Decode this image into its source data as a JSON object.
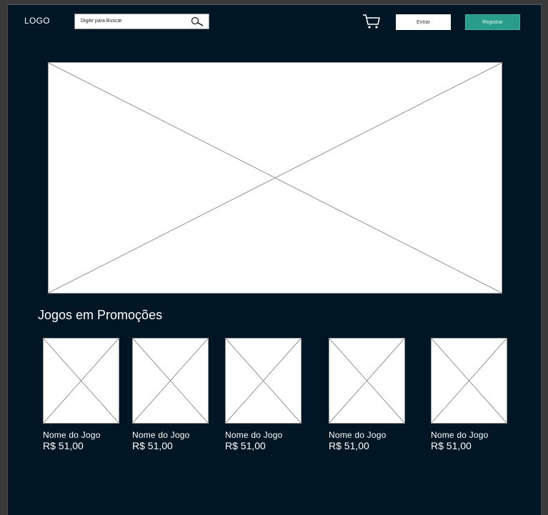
{
  "header": {
    "logo": "LOGO",
    "search_placeholder": "Digite para Buscar",
    "login_label": "Entrar",
    "register_label": "Registrar",
    "icons": [
      "search-icon",
      "cart-icon"
    ]
  },
  "section": {
    "title": "Jogos em Promoções"
  },
  "games": [
    {
      "name": "Nome do Jogo",
      "price": "R$ 51,00"
    },
    {
      "name": "Nome do Jogo",
      "price": "R$ 51,00"
    },
    {
      "name": "Nome do Jogo",
      "price": "R$ 51,00"
    },
    {
      "name": "Nome do Jogo",
      "price": "R$ 51,00"
    },
    {
      "name": "Nome do Jogo",
      "price": "R$ 51,00"
    }
  ],
  "colors": {
    "background": "#011624",
    "accent": "#2a9d8a"
  }
}
